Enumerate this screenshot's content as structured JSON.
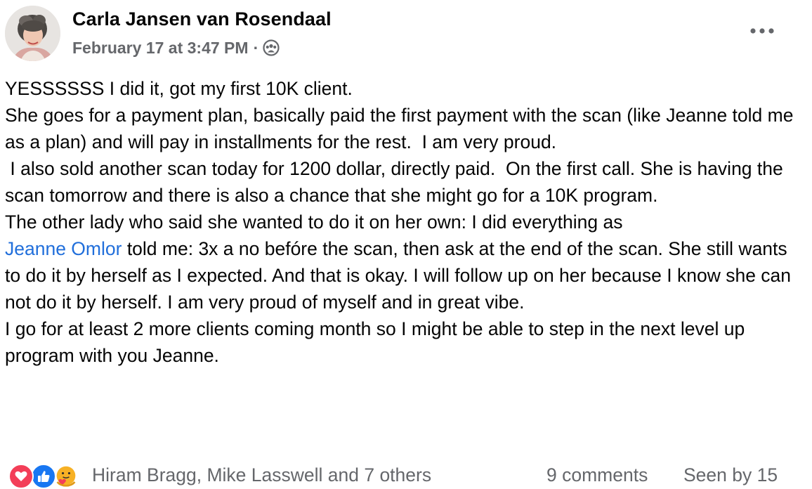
{
  "post": {
    "author": "Carla Jansen van Rosendaal",
    "date": "February 17 at 3:47 PM",
    "separator": "·",
    "audience_icon": "group-icon",
    "more_icon": "more-options-icon",
    "paragraphs": [
      "YESSSSSS I did it, got my first 10K client.",
      "She goes for a payment plan, basically paid the first payment with the scan (like Jeanne told me as a plan) and will pay in installments for the rest.  I am very proud.",
      " I also sold another scan today for 1200 dollar, directly paid.  On the first call. She is having the scan tomorrow and there is also a chance that she might go for a 10K program.",
      "The other lady who said she wanted to do it on her own: I did everything as"
    ],
    "mention": "Jeanne Omlor",
    "after_mention": " told me: 3x a no befóre the scan, then ask at the end of the scan. She still wants to do it by herself as I expected. And that is okay. I will follow up on her because I know she can not do it by herself. I am very proud of myself and in great vibe.",
    "closing": "I go for at least 2 more clients coming month so I might be able to step in the next level up program with you Jeanne."
  },
  "footer": {
    "reactions": [
      "love-icon",
      "like-icon",
      "care-icon"
    ],
    "reactors": "Hiram Bragg, Mike Lasswell and 7 others",
    "comments": "9 comments",
    "seen": "Seen by 15"
  },
  "colors": {
    "text": "#050505",
    "secondary": "#65676b",
    "link": "#216fdb",
    "love": "#f33e58",
    "like": "#1877f2",
    "care": "#f7b125"
  }
}
